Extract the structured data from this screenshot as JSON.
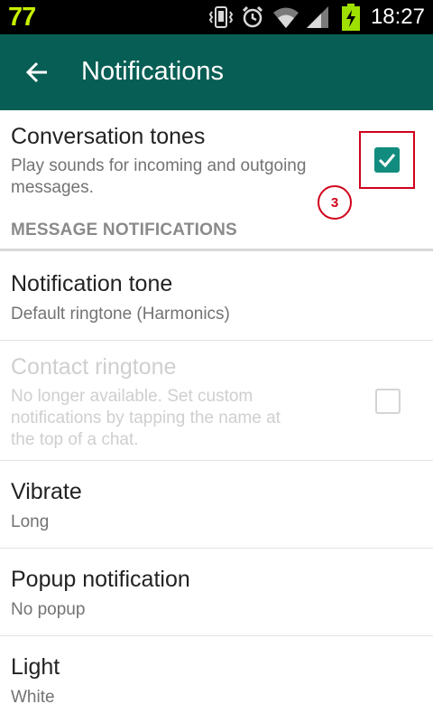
{
  "status_bar": {
    "badge": "77",
    "time": "18:27",
    "icons": [
      "vibrate-icon",
      "alarm-icon",
      "wifi-icon",
      "signal-icon",
      "battery-charging-icon"
    ]
  },
  "app_bar": {
    "back_icon": "arrow-back-icon",
    "title": "Notifications"
  },
  "conversation_tones": {
    "title": "Conversation tones",
    "subtitle_line1": "Play sounds for incoming and outgoing",
    "subtitle_line2": "messages.",
    "checked": true
  },
  "annotation": {
    "step": "3"
  },
  "section_header": "MESSAGE NOTIFICATIONS",
  "notification_tone": {
    "title": "Notification tone",
    "subtitle": "Default ringtone (Harmonics)"
  },
  "contact_ringtone": {
    "title": "Contact ringtone",
    "subtitle_line1": "No longer available. Set custom",
    "subtitle_line2": "notifications by tapping the name at",
    "subtitle_line3": "the top of a chat.",
    "checked": false,
    "enabled": false
  },
  "vibrate": {
    "title": "Vibrate",
    "subtitle": "Long"
  },
  "popup_notification": {
    "title": "Popup notification",
    "subtitle": "No popup"
  },
  "light": {
    "title": "Light",
    "subtitle": "White"
  },
  "colors": {
    "status_bar": "#000000",
    "app_bar": "#075e54",
    "checkbox": "#128c7e",
    "annotation": "#d0021b",
    "badge": "#c6f000"
  }
}
